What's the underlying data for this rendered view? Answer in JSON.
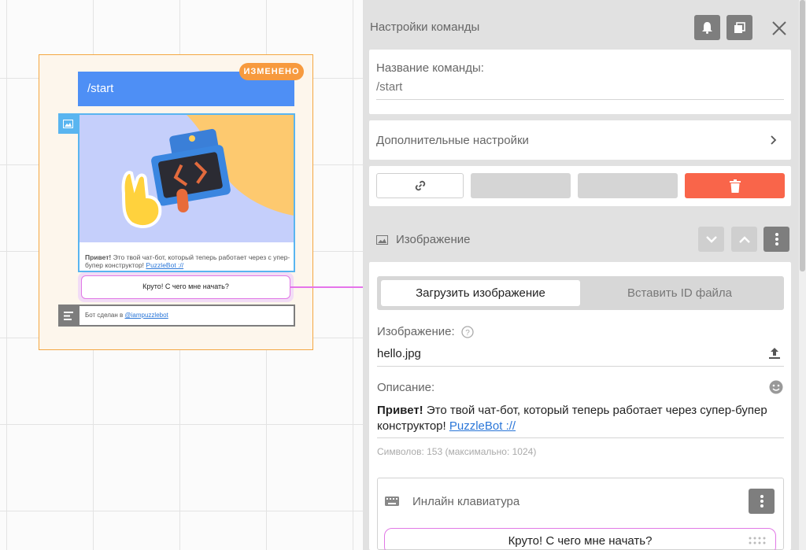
{
  "canvas": {
    "badge": "ИЗМЕНЕНО",
    "command": "/start",
    "caption_bold": "Привет!",
    "caption_rest": " Это твой чат-бот, который теперь работает через с упер-бупер конструктор! ",
    "caption_link": "PuzzleBot ://",
    "button_label": "Круто! С чего мне начать?",
    "footer_prefix": "Бот сделан в ",
    "footer_link": "@iampuzzlebot"
  },
  "panel": {
    "title": "Настройки команды",
    "command_name_label": "Название команды:",
    "command_name_placeholder": "/start",
    "additional_settings": "Дополнительные настройки",
    "section_image": "Изображение",
    "tabs": [
      "Загрузить изображение",
      "Вставить ID файла"
    ],
    "image_label": "Изображение:",
    "image_file": "hello.jpg",
    "description_label": "Описание:",
    "description_bold": "Привет!",
    "description_rest": " Это твой чат-бот, который теперь работает через супер-бупер конструктор! ",
    "description_link": "PuzzleBot ://",
    "char_count": "Символов: 153 (максимально: 1024)",
    "inline_keyboard_label": "Инлайн клавиатура",
    "inline_button": "Круто! С чего мне начать?"
  },
  "colors": {
    "accent_blue": "#4e8ff5",
    "badge_orange": "#f79a3e",
    "delete_red": "#f9654a",
    "keyboard_pink": "#e178e6"
  },
  "icons": [
    "bell-icon",
    "copy-icon",
    "close-icon",
    "link-icon",
    "trash-icon",
    "image-icon",
    "chevron-right-icon",
    "chevron-down-icon",
    "chevron-up-icon",
    "more-vert-icon",
    "help-icon",
    "upload-icon",
    "emoji-icon",
    "keyboard-icon",
    "drag-handle-icon",
    "text-icon"
  ]
}
